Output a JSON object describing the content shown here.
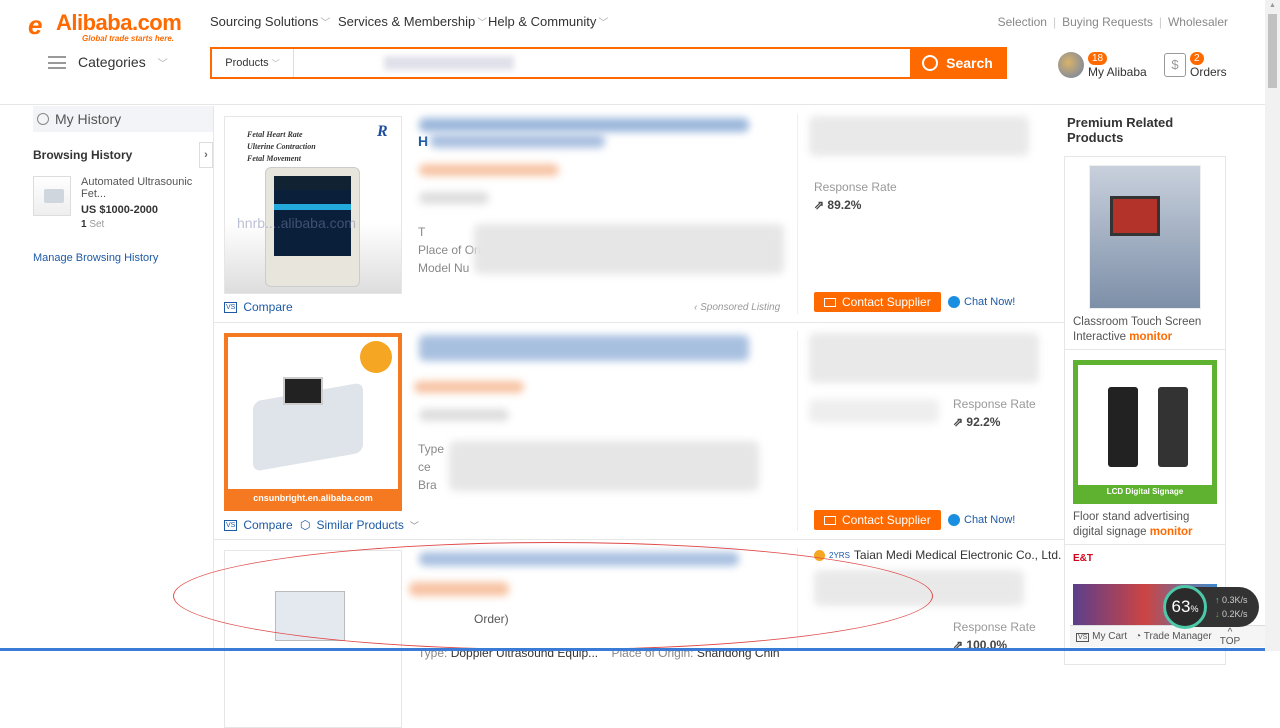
{
  "header": {
    "logo": {
      "brand": "Alibaba.com",
      "tagline": "Global trade starts here."
    },
    "nav": [
      "Sourcing Solutions",
      "Services & Membership",
      "Help & Community"
    ],
    "top_links": [
      "Selection",
      "Buying Requests",
      "Wholesaler"
    ],
    "categories_label": "Categories",
    "search": {
      "scope": "Products",
      "query": "",
      "button": "Search"
    },
    "my_alibaba": {
      "label": "My Alibaba",
      "badge": "18"
    },
    "orders": {
      "label": "Orders",
      "badge": "2"
    },
    "accent": "#ff6a00"
  },
  "history": {
    "title": "My History",
    "browsing_title": "Browsing History",
    "item": {
      "title": "Automated Ultrasounic Fet...",
      "price": "US $1000-2000",
      "qty": "1",
      "unit": "Set"
    },
    "manage": "Manage Browsing History"
  },
  "results": [
    {
      "image_text": [
        "Fetal Heart Rate",
        "Ulterine Contraction",
        "Fetal Movement"
      ],
      "watermark": "hnrb....alibaba.com",
      "title_first": "H",
      "specs": [
        "T",
        "Place of Origi",
        "Model Nu"
      ],
      "response_label": "Response Rate",
      "response": "89.2%",
      "compare": "Compare",
      "sponsored": "Sponsored Listing",
      "contact": "Contact Supplier",
      "chat": "Chat Now!"
    },
    {
      "image_text": "cnsunbright.en.alibaba.com",
      "specs": [
        "Type",
        "ce",
        "Bra"
      ],
      "response_label": "Response Rate",
      "response": "92.2%",
      "compare": "Compare",
      "similar": "Similar Products",
      "contact": "Contact Supplier",
      "chat": "Chat Now!"
    },
    {
      "supplier": "Taian Medi Medical Electronic Co., Ltd.",
      "supplier_years": "2YRS",
      "order_fragment": "Order)",
      "spec_type": "Type:",
      "spec_type_val": "Doppler Ultrasound Equip...",
      "spec_origin": "Place of Origin:",
      "spec_origin_val": "Shandong Chin",
      "response_label": "Response Rate",
      "response": "100.0%"
    }
  ],
  "premium": {
    "title": "Premium Related Products",
    "items": [
      {
        "caption": "Classroom Touch Screen Interactive",
        "keyword": "monitor"
      },
      {
        "caption": "Floor stand advertising digital signage",
        "keyword": "monitor",
        "banner": "LCD Digital Signage"
      },
      {
        "brand_mark": "E&T"
      }
    ]
  },
  "footer_bar": {
    "cart": "My Cart",
    "trade_manager": "Trade Manager",
    "top": "TOP"
  },
  "net_monitor": {
    "percent": "63",
    "unit": "%",
    "up": "0.3",
    "down": "0.2",
    "speed_unit": "K/s"
  }
}
